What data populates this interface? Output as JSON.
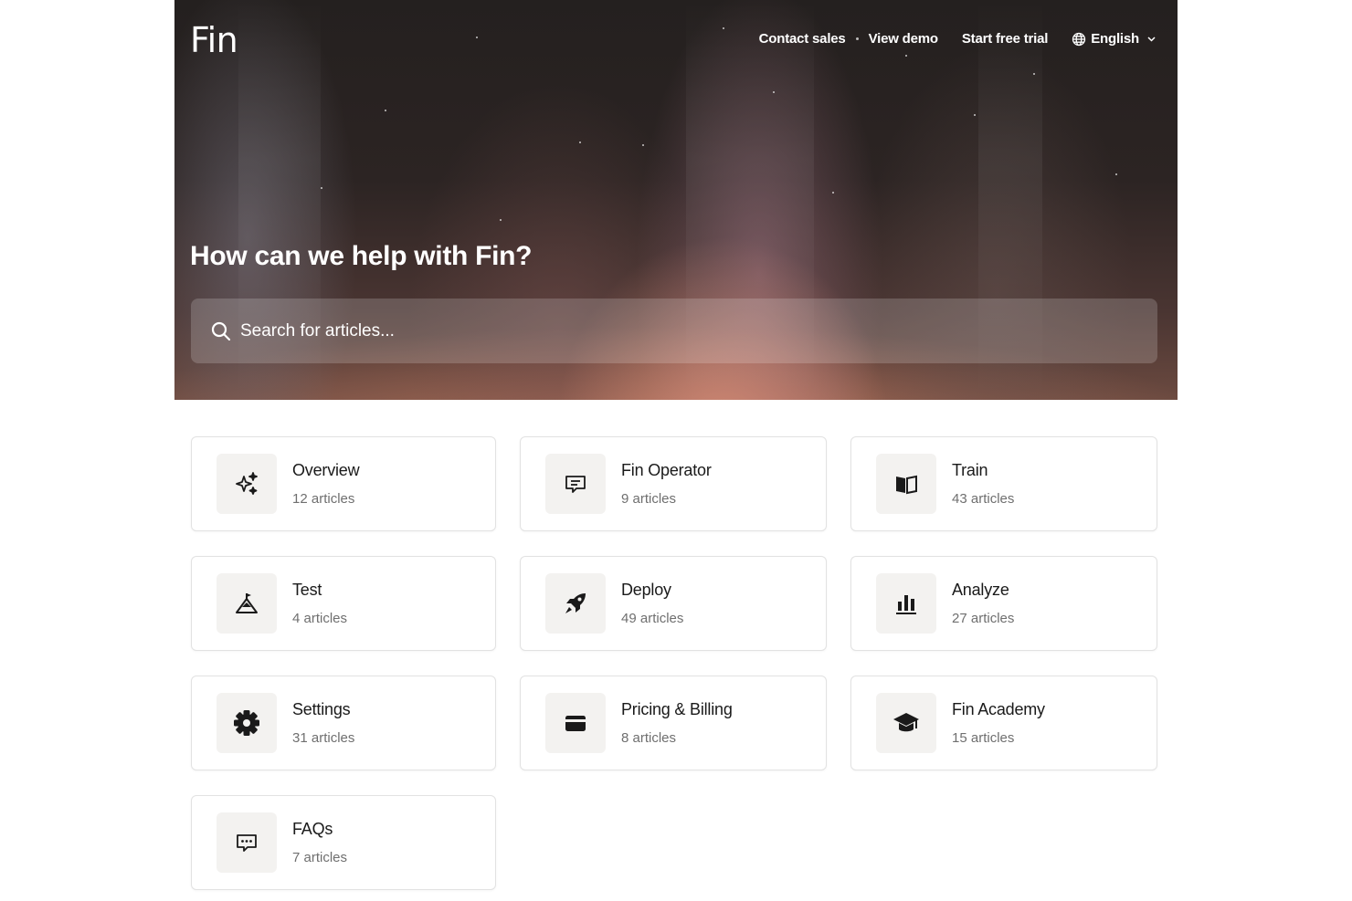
{
  "brand": {
    "logo_text": "Fin"
  },
  "nav": {
    "contact_sales": "Contact sales",
    "view_demo": "View demo",
    "start_free_trial": "Start free trial",
    "language": "English"
  },
  "hero": {
    "title": "How can we help with Fin?",
    "search_placeholder": "Search for articles..."
  },
  "collections": [
    {
      "name": "Overview",
      "count": "12 articles",
      "icon": "sparkles-icon"
    },
    {
      "name": "Fin Operator",
      "count": "9 articles",
      "icon": "chat-bubble-lines-icon"
    },
    {
      "name": "Train",
      "count": "43 articles",
      "icon": "open-book-icon"
    },
    {
      "name": "Test",
      "count": "4 articles",
      "icon": "mountain-flag-icon"
    },
    {
      "name": "Deploy",
      "count": "49 articles",
      "icon": "rocket-icon"
    },
    {
      "name": "Analyze",
      "count": "27 articles",
      "icon": "bar-chart-icon"
    },
    {
      "name": "Settings",
      "count": "31 articles",
      "icon": "gear-icon"
    },
    {
      "name": "Pricing & Billing",
      "count": "8 articles",
      "icon": "credit-card-icon"
    },
    {
      "name": "Fin Academy",
      "count": "15 articles",
      "icon": "graduation-cap-icon"
    },
    {
      "name": "FAQs",
      "count": "7 articles",
      "icon": "chat-bubble-dots-icon"
    }
  ],
  "colors": {
    "text_primary": "#1a1a1a",
    "text_secondary": "#6f6f6f",
    "icon_tile_bg": "#f3f2f0",
    "card_border": "#e2e2e2"
  }
}
